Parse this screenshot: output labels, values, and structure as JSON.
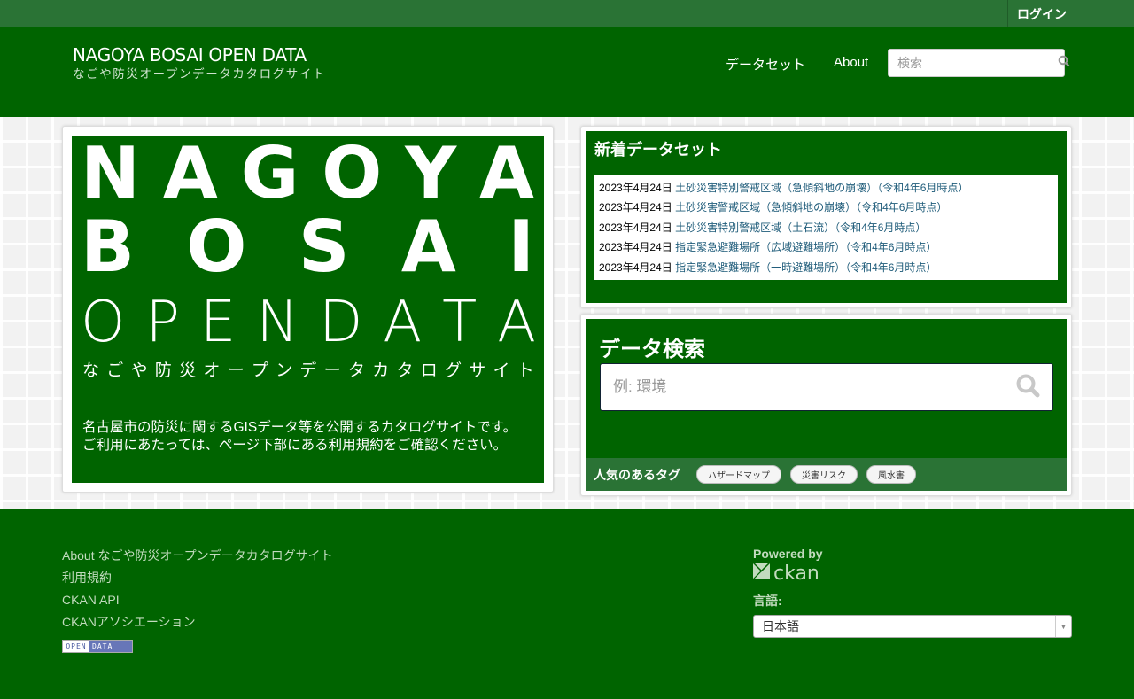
{
  "account": {
    "login_label": "ログイン"
  },
  "header": {
    "logo_title": "NAGOYA BOSAI OPEN DATA",
    "logo_subtitle": "なごや防災オープンデータカタログサイト",
    "nav": [
      {
        "label": "データセット"
      },
      {
        "label": "About"
      }
    ],
    "search_placeholder": "検索",
    "search_icon": "search-icon"
  },
  "hero": {
    "line1": [
      "N",
      "A",
      "G",
      "O",
      "Y",
      "A"
    ],
    "line2": [
      "B",
      "O",
      "S",
      "A",
      "I"
    ],
    "line3": [
      "O",
      "P",
      "E",
      "N",
      "D",
      "A",
      "T",
      "A"
    ],
    "line4": [
      "な",
      "ご",
      "や",
      "防",
      "災",
      "オ",
      "ー",
      "プ",
      "ン",
      "デ",
      "ー",
      "タ",
      "カ",
      "タ",
      "ロ",
      "グ",
      "サ",
      "イ",
      "ト"
    ],
    "description_line1": "名古屋市の防災に関するGISデータ等を公開するカタログサイトです。",
    "description_line2": "ご利用にあたっては、ページ下部にある利用規約をご確認ください。"
  },
  "new_datasets": {
    "title": "新着データセット",
    "items": [
      {
        "date": "2023年4月24日",
        "title": "土砂災害特別警戒区域（急傾斜地の崩壊）（令和4年6月時点）"
      },
      {
        "date": "2023年4月24日",
        "title": "土砂災害警戒区域（急傾斜地の崩壊）（令和4年6月時点）"
      },
      {
        "date": "2023年4月24日",
        "title": "土砂災害特別警戒区域（土石流）（令和4年6月時点）"
      },
      {
        "date": "2023年4月24日",
        "title": "指定緊急避難場所（広域避難場所）（令和4年6月時点）"
      },
      {
        "date": "2023年4月24日",
        "title": "指定緊急避難場所（一時避難場所）（令和4年6月時点）"
      }
    ]
  },
  "data_search": {
    "title": "データ検索",
    "placeholder": "例: 環境",
    "tags_label": "人気のあるタグ",
    "tags": [
      "ハザードマップ",
      "災害リスク",
      "風水害"
    ]
  },
  "footer": {
    "links": [
      "About なごや防災オープンデータカタログサイト",
      "利用規約",
      "CKAN API",
      "CKANアソシエーション"
    ],
    "open_data_badge": {
      "left": "OPEN",
      "right": "DATA"
    },
    "powered_by": "Powered by",
    "ckan_text": "ckan",
    "language_label": "言語:",
    "language_selected": "日本語"
  },
  "colors": {
    "brand_green": "#006400",
    "bar_green": "#2a7335",
    "link": "#1f5c7a",
    "footer_text": "#c2dbbe"
  }
}
